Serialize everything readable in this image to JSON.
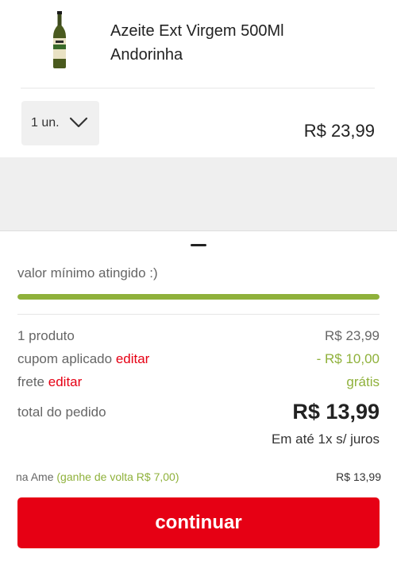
{
  "product": {
    "name_line1": "Azeite Ext Virgem 500Ml",
    "name_line2": "Andorinha",
    "image_icon": "olive-oil-bottle-icon",
    "quantity": "1 un.",
    "price": "R$ 23,99"
  },
  "summary": {
    "min_value_message": "valor mínimo atingido :)",
    "progress_fraction": 1.0,
    "rows": {
      "products": {
        "label": "1 produto",
        "value": "R$ 23,99"
      },
      "coupon": {
        "label": "cupom aplicado",
        "link": "editar",
        "value": "- R$ 10,00"
      },
      "shipping": {
        "label": "frete",
        "link": "editar",
        "value": "grátis"
      },
      "total": {
        "label": "total do pedido",
        "value": "R$ 13,99"
      }
    },
    "installments": "Em até 1x s/ juros",
    "ame": {
      "label": "na Ame",
      "cashback": "(ganhe de volta R$ 7,00)",
      "value": "R$ 13,99"
    },
    "continue_button": "continuar"
  },
  "colors": {
    "accent_red": "#e60014",
    "accent_green": "#8fb13b"
  }
}
